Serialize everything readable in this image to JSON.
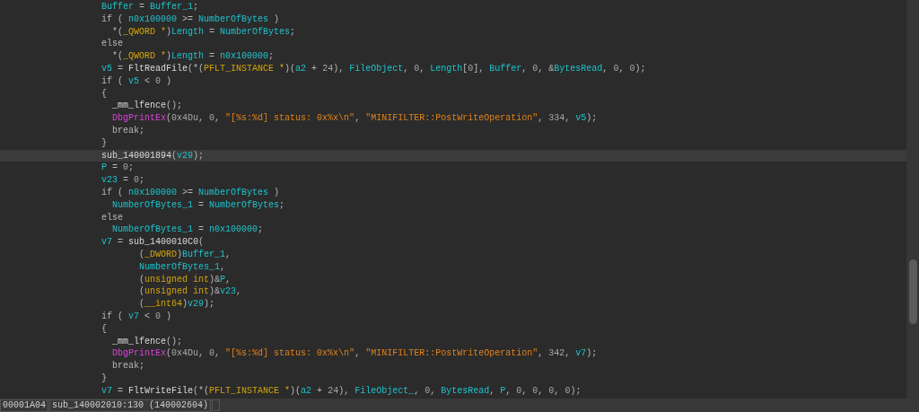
{
  "code_lines": [
    {
      "selected": false,
      "tokens": [
        {
          "kind": "var",
          "text": "Buffer"
        },
        {
          "kind": "plain",
          "text": " = "
        },
        {
          "kind": "var",
          "text": "Buffer_1"
        },
        {
          "kind": "plain",
          "text": ";"
        }
      ]
    },
    {
      "selected": false,
      "tokens": [
        {
          "kind": "plain",
          "text": "if ( "
        },
        {
          "kind": "var",
          "text": "n0x100000"
        },
        {
          "kind": "plain",
          "text": " >= "
        },
        {
          "kind": "var",
          "text": "NumberOfBytes"
        },
        {
          "kind": "plain",
          "text": " )"
        }
      ]
    },
    {
      "selected": false,
      "tokens": [
        {
          "kind": "plain",
          "text": "  *("
        },
        {
          "kind": "type",
          "text": "_QWORD *"
        },
        {
          "kind": "plain",
          "text": ")"
        },
        {
          "kind": "var",
          "text": "Length"
        },
        {
          "kind": "plain",
          "text": " = "
        },
        {
          "kind": "var",
          "text": "NumberOfBytes"
        },
        {
          "kind": "plain",
          "text": ";"
        }
      ]
    },
    {
      "selected": false,
      "tokens": [
        {
          "kind": "plain",
          "text": "else"
        }
      ]
    },
    {
      "selected": false,
      "tokens": [
        {
          "kind": "plain",
          "text": "  *("
        },
        {
          "kind": "type",
          "text": "_QWORD *"
        },
        {
          "kind": "plain",
          "text": ")"
        },
        {
          "kind": "var",
          "text": "Length"
        },
        {
          "kind": "plain",
          "text": " = "
        },
        {
          "kind": "var",
          "text": "n0x100000"
        },
        {
          "kind": "plain",
          "text": ";"
        }
      ]
    },
    {
      "selected": false,
      "tokens": [
        {
          "kind": "var",
          "text": "v5"
        },
        {
          "kind": "plain",
          "text": " = "
        },
        {
          "kind": "func",
          "text": "FltReadFile"
        },
        {
          "kind": "plain",
          "text": "(*("
        },
        {
          "kind": "type",
          "text": "PFLT_INSTANCE *"
        },
        {
          "kind": "plain",
          "text": ")("
        },
        {
          "kind": "var",
          "text": "a2"
        },
        {
          "kind": "plain",
          "text": " + "
        },
        {
          "kind": "number",
          "text": "24"
        },
        {
          "kind": "plain",
          "text": "), "
        },
        {
          "kind": "var",
          "text": "FileObject"
        },
        {
          "kind": "plain",
          "text": ", "
        },
        {
          "kind": "number",
          "text": "0"
        },
        {
          "kind": "plain",
          "text": ", "
        },
        {
          "kind": "var",
          "text": "Length"
        },
        {
          "kind": "plain",
          "text": "["
        },
        {
          "kind": "number",
          "text": "0"
        },
        {
          "kind": "plain",
          "text": "], "
        },
        {
          "kind": "var",
          "text": "Buffer"
        },
        {
          "kind": "plain",
          "text": ", "
        },
        {
          "kind": "number",
          "text": "0"
        },
        {
          "kind": "plain",
          "text": ", &"
        },
        {
          "kind": "var",
          "text": "BytesRead"
        },
        {
          "kind": "plain",
          "text": ", "
        },
        {
          "kind": "number",
          "text": "0"
        },
        {
          "kind": "plain",
          "text": ", "
        },
        {
          "kind": "number",
          "text": "0"
        },
        {
          "kind": "plain",
          "text": ");"
        }
      ]
    },
    {
      "selected": false,
      "tokens": [
        {
          "kind": "plain",
          "text": "if ( "
        },
        {
          "kind": "var",
          "text": "v5"
        },
        {
          "kind": "plain",
          "text": " < "
        },
        {
          "kind": "number",
          "text": "0"
        },
        {
          "kind": "plain",
          "text": " )"
        }
      ]
    },
    {
      "selected": false,
      "tokens": [
        {
          "kind": "plain",
          "text": "{"
        }
      ]
    },
    {
      "selected": false,
      "tokens": [
        {
          "kind": "func",
          "text": "  _mm_lfence"
        },
        {
          "kind": "plain",
          "text": "();"
        }
      ]
    },
    {
      "selected": false,
      "tokens": [
        {
          "kind": "import",
          "text": "  DbgPrintEx"
        },
        {
          "kind": "plain",
          "text": "("
        },
        {
          "kind": "number",
          "text": "0x4Du"
        },
        {
          "kind": "plain",
          "text": ", "
        },
        {
          "kind": "number",
          "text": "0"
        },
        {
          "kind": "plain",
          "text": ", "
        },
        {
          "kind": "string",
          "text": "\"[%s:%d] status: 0x%x\\n\""
        },
        {
          "kind": "plain",
          "text": ", "
        },
        {
          "kind": "string",
          "text": "\"MINIFILTER::PostWriteOperation\""
        },
        {
          "kind": "plain",
          "text": ", "
        },
        {
          "kind": "number",
          "text": "334"
        },
        {
          "kind": "plain",
          "text": ", "
        },
        {
          "kind": "var",
          "text": "v5"
        },
        {
          "kind": "plain",
          "text": ");"
        }
      ]
    },
    {
      "selected": false,
      "tokens": [
        {
          "kind": "plain",
          "text": "  break;"
        }
      ]
    },
    {
      "selected": false,
      "tokens": [
        {
          "kind": "plain",
          "text": "}"
        }
      ]
    },
    {
      "selected": true,
      "tokens": [
        {
          "kind": "func",
          "text": "sub_140001894"
        },
        {
          "kind": "plain",
          "text": "("
        },
        {
          "kind": "var",
          "text": "v29"
        },
        {
          "kind": "plain",
          "text": ");"
        }
      ]
    },
    {
      "selected": false,
      "tokens": [
        {
          "kind": "var",
          "text": "P"
        },
        {
          "kind": "plain",
          "text": " = "
        },
        {
          "kind": "number",
          "text": "0"
        },
        {
          "kind": "plain",
          "text": ";"
        }
      ]
    },
    {
      "selected": false,
      "tokens": [
        {
          "kind": "var",
          "text": "v23"
        },
        {
          "kind": "plain",
          "text": " = "
        },
        {
          "kind": "number",
          "text": "0"
        },
        {
          "kind": "plain",
          "text": ";"
        }
      ]
    },
    {
      "selected": false,
      "tokens": [
        {
          "kind": "plain",
          "text": "if ( "
        },
        {
          "kind": "var",
          "text": "n0x100000"
        },
        {
          "kind": "plain",
          "text": " >= "
        },
        {
          "kind": "var",
          "text": "NumberOfBytes"
        },
        {
          "kind": "plain",
          "text": " )"
        }
      ]
    },
    {
      "selected": false,
      "tokens": [
        {
          "kind": "var",
          "text": "  NumberOfBytes_1"
        },
        {
          "kind": "plain",
          "text": " = "
        },
        {
          "kind": "var",
          "text": "NumberOfBytes"
        },
        {
          "kind": "plain",
          "text": ";"
        }
      ]
    },
    {
      "selected": false,
      "tokens": [
        {
          "kind": "plain",
          "text": "else"
        }
      ]
    },
    {
      "selected": false,
      "tokens": [
        {
          "kind": "var",
          "text": "  NumberOfBytes_1"
        },
        {
          "kind": "plain",
          "text": " = "
        },
        {
          "kind": "var",
          "text": "n0x100000"
        },
        {
          "kind": "plain",
          "text": ";"
        }
      ]
    },
    {
      "selected": false,
      "tokens": [
        {
          "kind": "var",
          "text": "v7"
        },
        {
          "kind": "plain",
          "text": " = "
        },
        {
          "kind": "func",
          "text": "sub_1400010C0"
        },
        {
          "kind": "plain",
          "text": "("
        }
      ]
    },
    {
      "selected": false,
      "tokens": [
        {
          "kind": "plain",
          "text": "       ("
        },
        {
          "kind": "type",
          "text": "_DWORD"
        },
        {
          "kind": "plain",
          "text": ")"
        },
        {
          "kind": "var",
          "text": "Buffer_1"
        },
        {
          "kind": "plain",
          "text": ","
        }
      ]
    },
    {
      "selected": false,
      "tokens": [
        {
          "kind": "var",
          "text": "       NumberOfBytes_1"
        },
        {
          "kind": "plain",
          "text": ","
        }
      ]
    },
    {
      "selected": false,
      "tokens": [
        {
          "kind": "plain",
          "text": "       ("
        },
        {
          "kind": "type",
          "text": "unsigned int"
        },
        {
          "kind": "plain",
          "text": ")&"
        },
        {
          "kind": "var",
          "text": "P"
        },
        {
          "kind": "plain",
          "text": ","
        }
      ]
    },
    {
      "selected": false,
      "tokens": [
        {
          "kind": "plain",
          "text": "       ("
        },
        {
          "kind": "type",
          "text": "unsigned int"
        },
        {
          "kind": "plain",
          "text": ")&"
        },
        {
          "kind": "var",
          "text": "v23"
        },
        {
          "kind": "plain",
          "text": ","
        }
      ]
    },
    {
      "selected": false,
      "tokens": [
        {
          "kind": "plain",
          "text": "       ("
        },
        {
          "kind": "type",
          "text": "__int64"
        },
        {
          "kind": "plain",
          "text": ")"
        },
        {
          "kind": "var",
          "text": "v29"
        },
        {
          "kind": "plain",
          "text": ");"
        }
      ]
    },
    {
      "selected": false,
      "tokens": [
        {
          "kind": "plain",
          "text": "if ( "
        },
        {
          "kind": "var",
          "text": "v7"
        },
        {
          "kind": "plain",
          "text": " < "
        },
        {
          "kind": "number",
          "text": "0"
        },
        {
          "kind": "plain",
          "text": " )"
        }
      ]
    },
    {
      "selected": false,
      "tokens": [
        {
          "kind": "plain",
          "text": "{"
        }
      ]
    },
    {
      "selected": false,
      "tokens": [
        {
          "kind": "func",
          "text": "  _mm_lfence"
        },
        {
          "kind": "plain",
          "text": "();"
        }
      ]
    },
    {
      "selected": false,
      "tokens": [
        {
          "kind": "import",
          "text": "  DbgPrintEx"
        },
        {
          "kind": "plain",
          "text": "("
        },
        {
          "kind": "number",
          "text": "0x4Du"
        },
        {
          "kind": "plain",
          "text": ", "
        },
        {
          "kind": "number",
          "text": "0"
        },
        {
          "kind": "plain",
          "text": ", "
        },
        {
          "kind": "string",
          "text": "\"[%s:%d] status: 0x%x\\n\""
        },
        {
          "kind": "plain",
          "text": ", "
        },
        {
          "kind": "string",
          "text": "\"MINIFILTER::PostWriteOperation\""
        },
        {
          "kind": "plain",
          "text": ", "
        },
        {
          "kind": "number",
          "text": "342"
        },
        {
          "kind": "plain",
          "text": ", "
        },
        {
          "kind": "var",
          "text": "v7"
        },
        {
          "kind": "plain",
          "text": ");"
        }
      ]
    },
    {
      "selected": false,
      "tokens": [
        {
          "kind": "plain",
          "text": "  break;"
        }
      ]
    },
    {
      "selected": false,
      "tokens": [
        {
          "kind": "plain",
          "text": "}"
        }
      ]
    },
    {
      "selected": false,
      "tokens": [
        {
          "kind": "var",
          "text": "v7"
        },
        {
          "kind": "plain",
          "text": " = "
        },
        {
          "kind": "func",
          "text": "FltWriteFile"
        },
        {
          "kind": "plain",
          "text": "(*("
        },
        {
          "kind": "type",
          "text": "PFLT_INSTANCE *"
        },
        {
          "kind": "plain",
          "text": ")("
        },
        {
          "kind": "var",
          "text": "a2"
        },
        {
          "kind": "plain",
          "text": " + "
        },
        {
          "kind": "number",
          "text": "24"
        },
        {
          "kind": "plain",
          "text": "), "
        },
        {
          "kind": "var",
          "text": "FileObject_"
        },
        {
          "kind": "plain",
          "text": ", "
        },
        {
          "kind": "number",
          "text": "0"
        },
        {
          "kind": "plain",
          "text": ", "
        },
        {
          "kind": "var",
          "text": "BytesRead"
        },
        {
          "kind": "plain",
          "text": ", "
        },
        {
          "kind": "var",
          "text": "P"
        },
        {
          "kind": "plain",
          "text": ", "
        },
        {
          "kind": "number",
          "text": "0"
        },
        {
          "kind": "plain",
          "text": ", "
        },
        {
          "kind": "number",
          "text": "0"
        },
        {
          "kind": "plain",
          "text": ", "
        },
        {
          "kind": "number",
          "text": "0"
        },
        {
          "kind": "plain",
          "text": ", "
        },
        {
          "kind": "number",
          "text": "0"
        },
        {
          "kind": "plain",
          "text": ");"
        }
      ]
    }
  ],
  "status_bar": {
    "offset": "00001A04",
    "location": "sub_140002010:130 (140002604)"
  }
}
